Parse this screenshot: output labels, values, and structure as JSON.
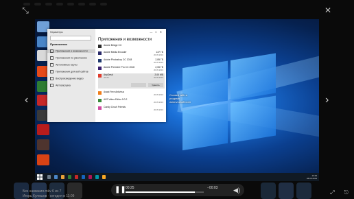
{
  "viewer": {
    "close_glyph": "✕",
    "shrink_glyph": "⤡",
    "prev_glyph": "‹",
    "next_glyph": "›"
  },
  "settings": {
    "window_title": "Параметры",
    "search_placeholder": "",
    "section_heading": "Приложения",
    "nav_items": [
      "Приложения и возможности",
      "Приложения по умолчанию",
      "Автономные карты",
      "Приложения для веб-сайтов",
      "Воспроизведение видео",
      "Автозагрузка"
    ],
    "page_title": "Приложения и возможности",
    "apps": [
      {
        "name": "Adobe Bridge CC",
        "size": "",
        "date": "",
        "icon_color": "#2b2b2b"
      },
      {
        "name": "Adobe Media Encoder",
        "size": "137 ГБ",
        "date": "20.05.2019",
        "icon_color": "#2a2a6a"
      },
      {
        "name": "Adobe Photoshop CC 2018",
        "size": "2,85 ГБ",
        "date": "20.05.2019",
        "icon_color": "#1f3a6e"
      },
      {
        "name": "Adobe Premiere Pro CC 2018",
        "size": "2,06 ГБ",
        "date": "20.05.2019",
        "icon_color": "#3a1f6e"
      },
      {
        "name": "AnyDesk",
        "size": "2,00 МБ",
        "date": "20.05.2019",
        "sub": "ef6.5.1",
        "icon_color": "#e03b2c"
      },
      {
        "name": "Avast Free Antivirus",
        "size": "",
        "date": "20.05.2019",
        "icon_color": "#f07d1a"
      },
      {
        "name": "AVS Video Editor 9.0.2",
        "size": "",
        "date": "20.05.2019",
        "icon_color": "#3a8a3a"
      },
      {
        "name": "Candy Crush Friends",
        "size": "",
        "date": "20.05.2019",
        "icon_color": "#d04aa0"
      }
    ],
    "modify_label": "",
    "uninstall_label": "Удалить"
  },
  "watermark": {
    "line1": "Created with a",
    "line2": "program",
    "line3": "www.vovsoft.com"
  },
  "taskbar": {
    "time": "13:29",
    "date": "28.05.2019"
  },
  "caption": {
    "title": "Без названия.mkv 6 из 7",
    "subtitle": "Игорь Кулешов · сегодня в 11:09"
  },
  "player": {
    "current": "00:25",
    "remaining": "−00:03",
    "progress": 0.89,
    "play_glyph": "❚❚",
    "volume_glyph": "◀)"
  },
  "bottom_right": {
    "fullscreen_glyph": "⤢",
    "share_glyph": "⎋"
  }
}
